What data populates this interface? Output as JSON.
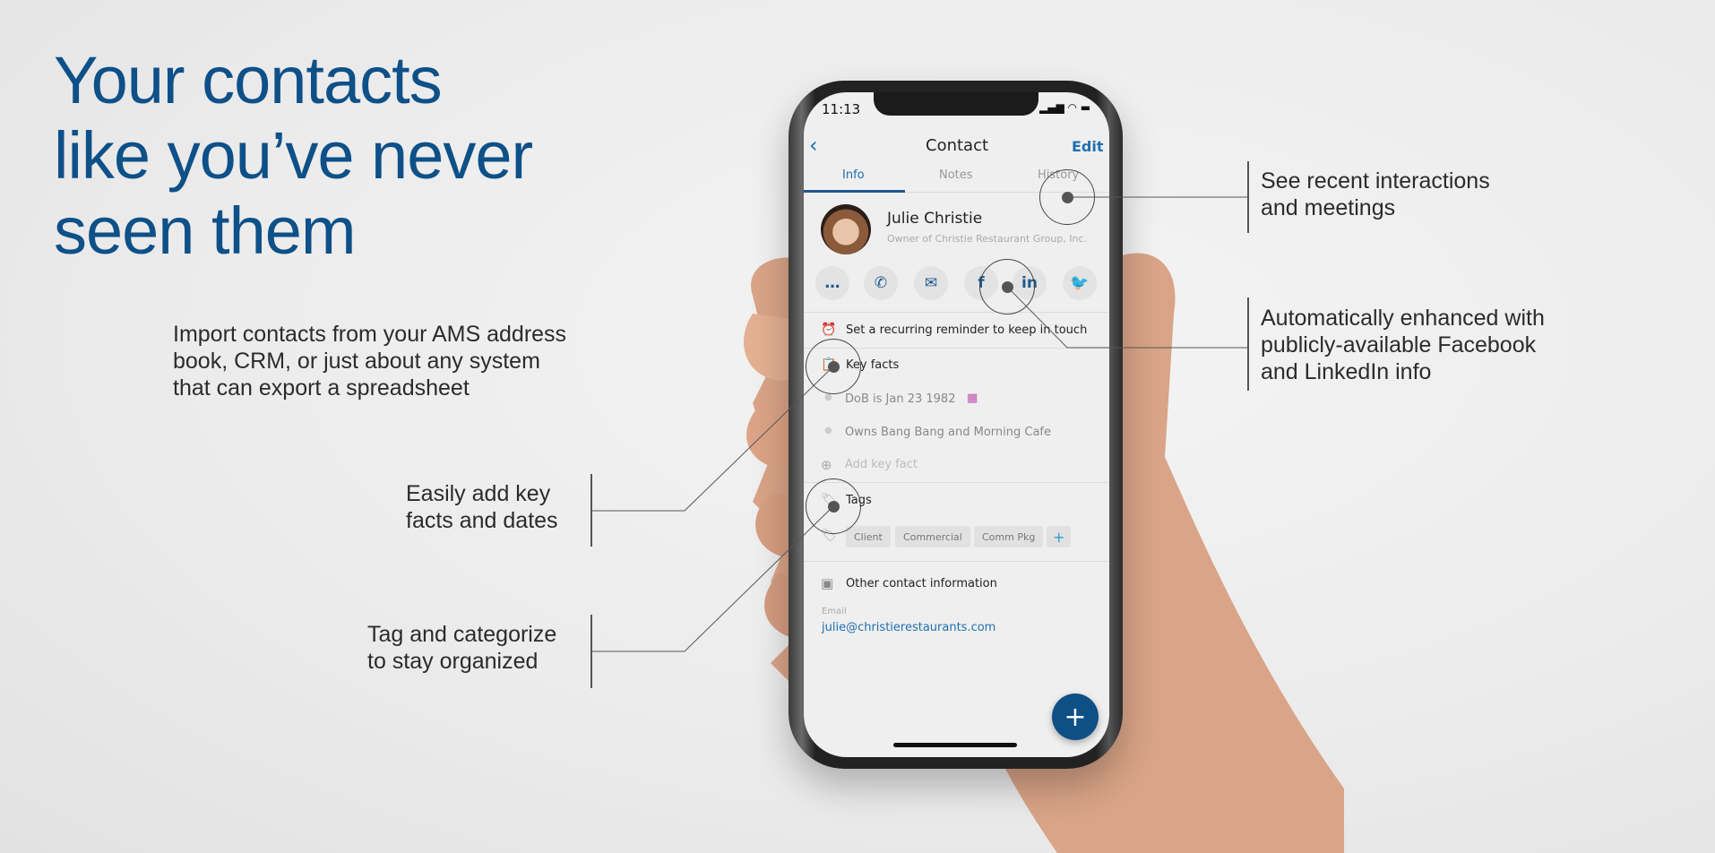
{
  "headline": {
    "line1": "Your contacts",
    "line2": "like you’ve never",
    "line3": "seen them"
  },
  "callouts": {
    "import": [
      "Import contacts from your AMS address",
      "book, CRM, or just about any system",
      "that can export a spreadsheet"
    ],
    "key_facts": [
      "Easily add key",
      "facts and dates"
    ],
    "tags": [
      "Tag and categorize",
      "to stay organized"
    ],
    "history": [
      "See recent interactions",
      "and meetings"
    ],
    "social": [
      "Automatically enhanced with",
      "publicly-available Facebook",
      "and LinkedIn info"
    ]
  },
  "phone": {
    "status_time": "11:13",
    "nav": {
      "title": "Contact",
      "edit": "Edit",
      "back_icon": "chevron-left-icon"
    },
    "tabs": [
      {
        "label": "Info",
        "active": true
      },
      {
        "label": "Notes"
      },
      {
        "label": "History"
      }
    ],
    "contact": {
      "name": "Julie Christie",
      "subtitle": "Owner of Christie Restaurant Group, Inc."
    },
    "actions": [
      "message-icon",
      "phone-icon",
      "mail-icon",
      "facebook-icon",
      "linkedin-icon",
      "twitter-icon"
    ],
    "reminder": "Set a recurring reminder to keep in touch",
    "key_facts": {
      "title": "Key facts",
      "items": [
        "DoB is Jan 23 1982",
        "Owns Bang Bang and Morning Cafe"
      ],
      "add": "Add key fact"
    },
    "tags": {
      "title": "Tags",
      "items": [
        "Client",
        "Commercial",
        "Comm Pkg"
      ],
      "add": "+"
    },
    "other": {
      "title": "Other contact information",
      "email_label": "Email",
      "email": "julie@christierestaurants.com"
    },
    "fab": "+"
  },
  "colors": {
    "brand": "#0e5088",
    "accent": "#1f6fb0"
  }
}
